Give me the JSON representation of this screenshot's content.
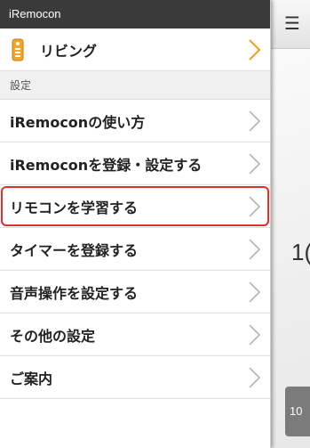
{
  "app": {
    "title": "iRemocon"
  },
  "room": {
    "label": "リビング",
    "icon": "remote-control-icon",
    "chevron_color": "#f0a020"
  },
  "settings_section": {
    "header": "設定",
    "items": [
      {
        "label": "iRemoconの使い方",
        "selected": false
      },
      {
        "label": "iRemoconを登録・設定する",
        "selected": false
      },
      {
        "label": "リモコンを学習する",
        "selected": true
      },
      {
        "label": "タイマーを登録する",
        "selected": false
      },
      {
        "label": "音声操作を設定する",
        "selected": false
      },
      {
        "label": "その他の設定",
        "selected": false
      },
      {
        "label": "ご案内",
        "selected": false
      }
    ]
  },
  "main_screen": {
    "menu_icon": "hamburger-menu-icon",
    "value_partial": "1(",
    "footer_partial": "10"
  },
  "colors": {
    "title_bar": "#3a3a3a",
    "selection_border": "#e03030",
    "accent_orange": "#f0a020"
  }
}
